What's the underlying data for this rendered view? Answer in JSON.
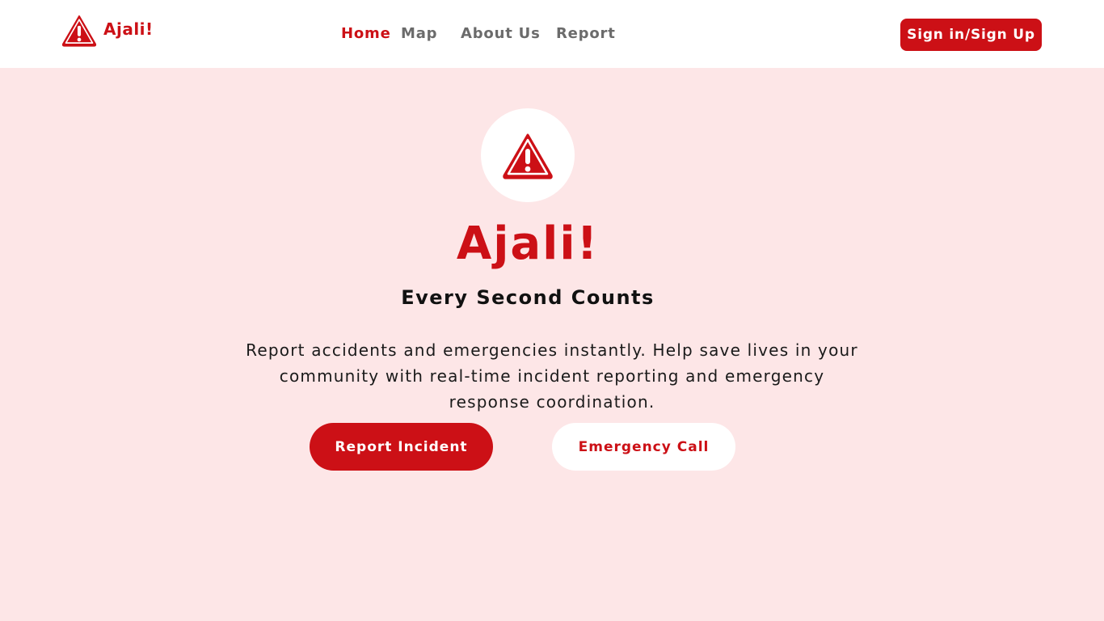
{
  "brand": {
    "name": "Ajali!",
    "icon": "warning-triangle-icon"
  },
  "nav": {
    "items": [
      {
        "label": "Home",
        "active": true
      },
      {
        "label": "Map",
        "active": false
      },
      {
        "label": "About Us",
        "active": false
      },
      {
        "label": "Report",
        "active": false
      }
    ]
  },
  "auth": {
    "label": "Sign in/Sign Up"
  },
  "hero": {
    "icon": "warning-triangle-icon",
    "title": "Ajali!",
    "tagline": "Every Second Counts",
    "description": "Report accidents and emergencies instantly. Help save lives in your community with real-time incident reporting and emergency response coordination.",
    "primary_button": "Report Incident",
    "secondary_button": "Emergency Call"
  },
  "colors": {
    "accent": "#cc1016",
    "page_background": "#fde6e7",
    "header_background": "#ffffff",
    "nav_inactive": "#6b6b6b"
  }
}
